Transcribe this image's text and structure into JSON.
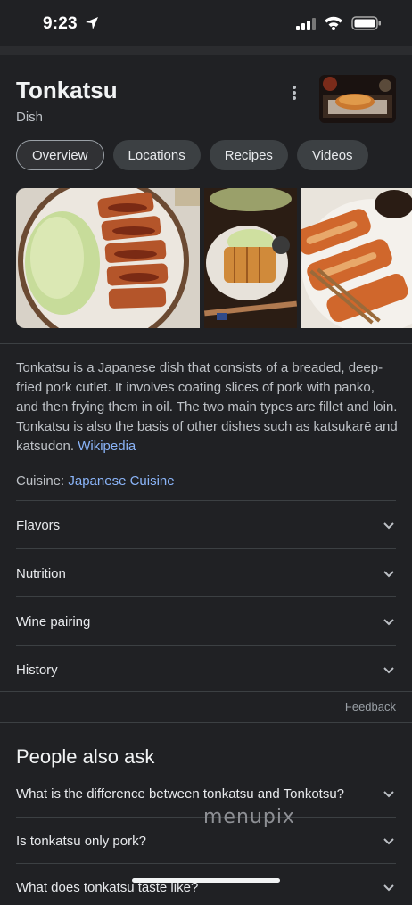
{
  "status_bar": {
    "time": "9:23"
  },
  "entity": {
    "title": "Tonkatsu",
    "subtitle": "Dish"
  },
  "tabs": [
    {
      "label": "Overview",
      "active": true
    },
    {
      "label": "Locations"
    },
    {
      "label": "Recipes"
    },
    {
      "label": "Videos"
    }
  ],
  "description": {
    "text": "Tonkatsu is a Japanese dish that consists of a breaded, deep-fried pork cutlet. It involves coating slices of pork with panko, and then frying them in oil. The two main types are fillet and loin. Tonkatsu is also the basis of other dishes such as katsukarē and katsudon.",
    "source_link": "Wikipedia"
  },
  "cuisine": {
    "label": "Cuisine:",
    "value": "Japanese Cuisine"
  },
  "accordions": [
    "Flavors",
    "Nutrition",
    "Wine pairing",
    "History"
  ],
  "feedback": "Feedback",
  "people_also_ask": {
    "title": "People also ask",
    "questions": [
      "What is the difference between tonkatsu and Tonkotsu?",
      "Is tonkatsu only pork?",
      "What does tonkatsu taste like?"
    ]
  },
  "watermark": "menupix",
  "colors": {
    "background": "#202124",
    "link": "#8ab4f8",
    "chip": "#3c4043"
  },
  "icons": [
    "location-arrow-icon",
    "signal-icon",
    "wifi-icon",
    "battery-icon",
    "more-vert-icon",
    "chevron-down-icon"
  ]
}
